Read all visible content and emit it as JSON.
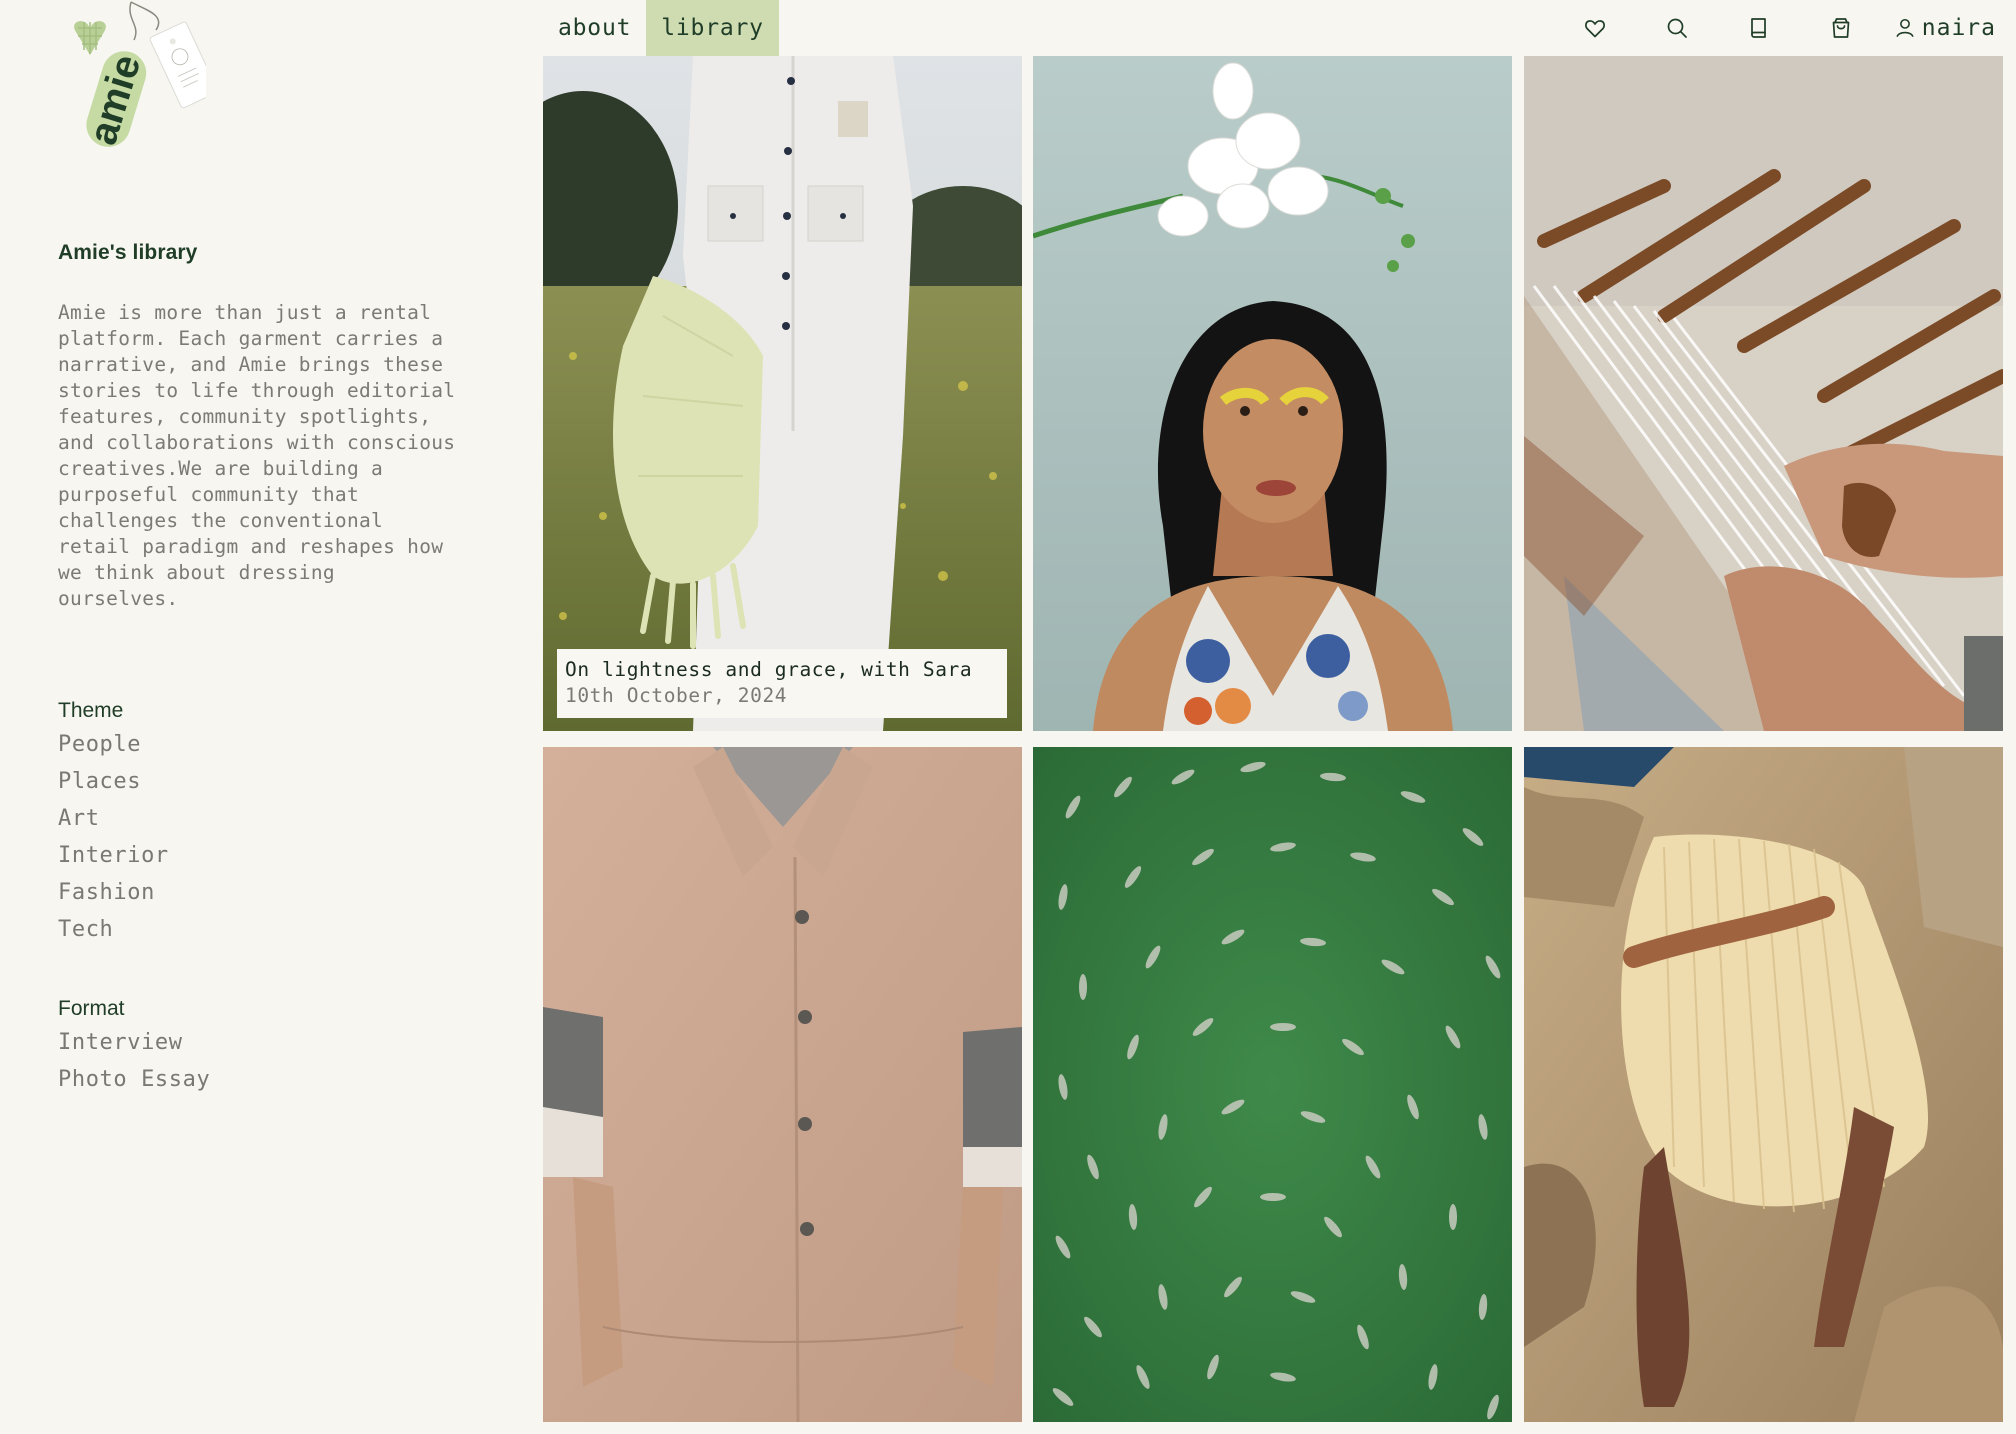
{
  "logo": {
    "wordmark": "amie"
  },
  "nav": {
    "items": [
      {
        "label": "about",
        "active": false
      },
      {
        "label": "library",
        "active": true
      }
    ]
  },
  "header_icons": [
    "heart-icon",
    "search-icon",
    "book-icon",
    "shopping-bag-icon",
    "user-icon"
  ],
  "account": {
    "username": "naira"
  },
  "sidebar": {
    "title": "Amie's library",
    "intro": "Amie is more than just a rental\nplatform. Each garment carries a\nnarrative, and Amie brings these\nstories to life through editorial\nfeatures, community spotlights,\nand collaborations with conscious\ncreatives.We are building a\npurposeful community that\nchallenges the conventional\nretail paradigm and reshapes how\nwe think about dressing\nourselves.",
    "theme": {
      "title": "Theme",
      "items": [
        "People",
        "Places",
        "Art",
        "Interior",
        "Fashion",
        "Tech"
      ]
    },
    "format": {
      "title": "Format",
      "items": [
        "Interview",
        "Photo Essay"
      ]
    }
  },
  "grid": {
    "cards": [
      {
        "image": "person in white shirt holding pale yellow blanket in flower field",
        "caption_title": "On lightness and grace, with Sara",
        "caption_date": "10th October, 2024"
      },
      {
        "image": "portrait of woman with yellow eyeshadow and white orchid"
      },
      {
        "image": "hands working on a loom with wooden shuttles"
      },
      {
        "image": "torso in pinkish-beige short-sleeved shirt"
      },
      {
        "image": "aerial view of fish swimming in green water"
      },
      {
        "image": "legs under a pleated cream fabric on rocks"
      }
    ]
  },
  "colors": {
    "background": "#f7f6f1",
    "brand_green": "#1f3d27",
    "active_nav": "#cfdcb2",
    "muted_text": "#7c7a74"
  }
}
